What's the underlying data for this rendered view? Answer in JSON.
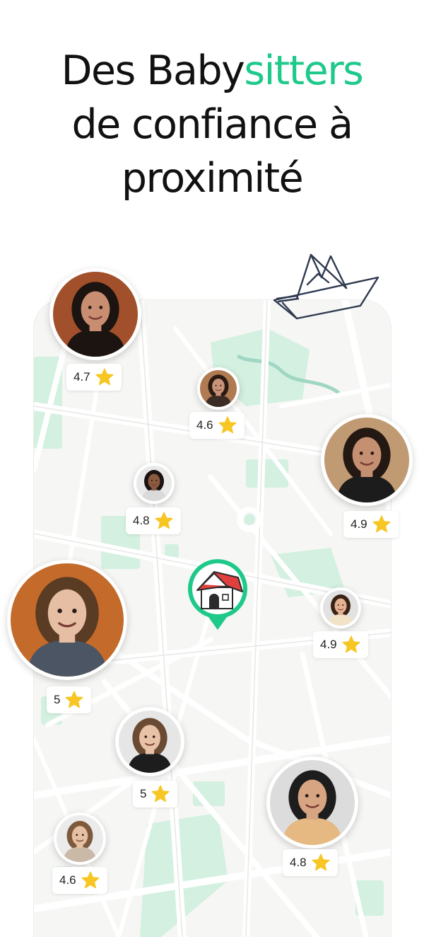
{
  "headline": {
    "line1_part1": "Des Baby",
    "line1_accent": "sitters",
    "line2": "de confiance à",
    "line3": "proximité"
  },
  "colors": {
    "accent": "#1ec98a",
    "star": "#f7c623",
    "park": "#d3f0e0",
    "road": "#ffffff",
    "map_bg": "#f6f6f4",
    "roof": "#e0413e"
  },
  "icons": {
    "decoration": "paper-boat-doodle",
    "home": "home-pin-icon",
    "rating": "star-icon"
  },
  "sitters": [
    {
      "id": "sitter-1",
      "rating": "4.7",
      "skin": "#c98e72",
      "hair": "#1b1411",
      "shirt": "#1b1411",
      "bg": "#a24f2b"
    },
    {
      "id": "sitter-2",
      "rating": "4.6",
      "skin": "#c89378",
      "hair": "#2b1a12",
      "shirt": "#3b2b25",
      "bg": "#b07a52"
    },
    {
      "id": "sitter-3",
      "rating": "4.9",
      "skin": "#c59072",
      "hair": "#241813",
      "shirt": "#1c1c1c",
      "bg": "#c09a72"
    },
    {
      "id": "sitter-4",
      "rating": "4.8",
      "skin": "#8a5a40",
      "hair": "#1a1311",
      "shirt": "#dadada",
      "bg": "#e9e9e9"
    },
    {
      "id": "sitter-5",
      "rating": "5",
      "skin": "#e5bea4",
      "hair": "#5a3b24",
      "shirt": "#4b5563",
      "bg": "#c46a2a"
    },
    {
      "id": "sitter-6",
      "rating": "4.9",
      "skin": "#e2b291",
      "hair": "#3a2216",
      "shirt": "#f2e3c8",
      "bg": "#e2e2e2"
    },
    {
      "id": "sitter-7",
      "rating": "5",
      "skin": "#e8c2a6",
      "hair": "#6b4a34",
      "shirt": "#1d1d1d",
      "bg": "#e6e6e6"
    },
    {
      "id": "sitter-8",
      "rating": "4.8",
      "skin": "#d8a582",
      "hair": "#1d1d1d",
      "shirt": "#e5b981",
      "bg": "#dcdcdc"
    },
    {
      "id": "sitter-9",
      "rating": "4.6",
      "skin": "#e6c0a3",
      "hair": "#7d5a3c",
      "shirt": "#c9b9a6",
      "bg": "#ebebeb"
    }
  ]
}
